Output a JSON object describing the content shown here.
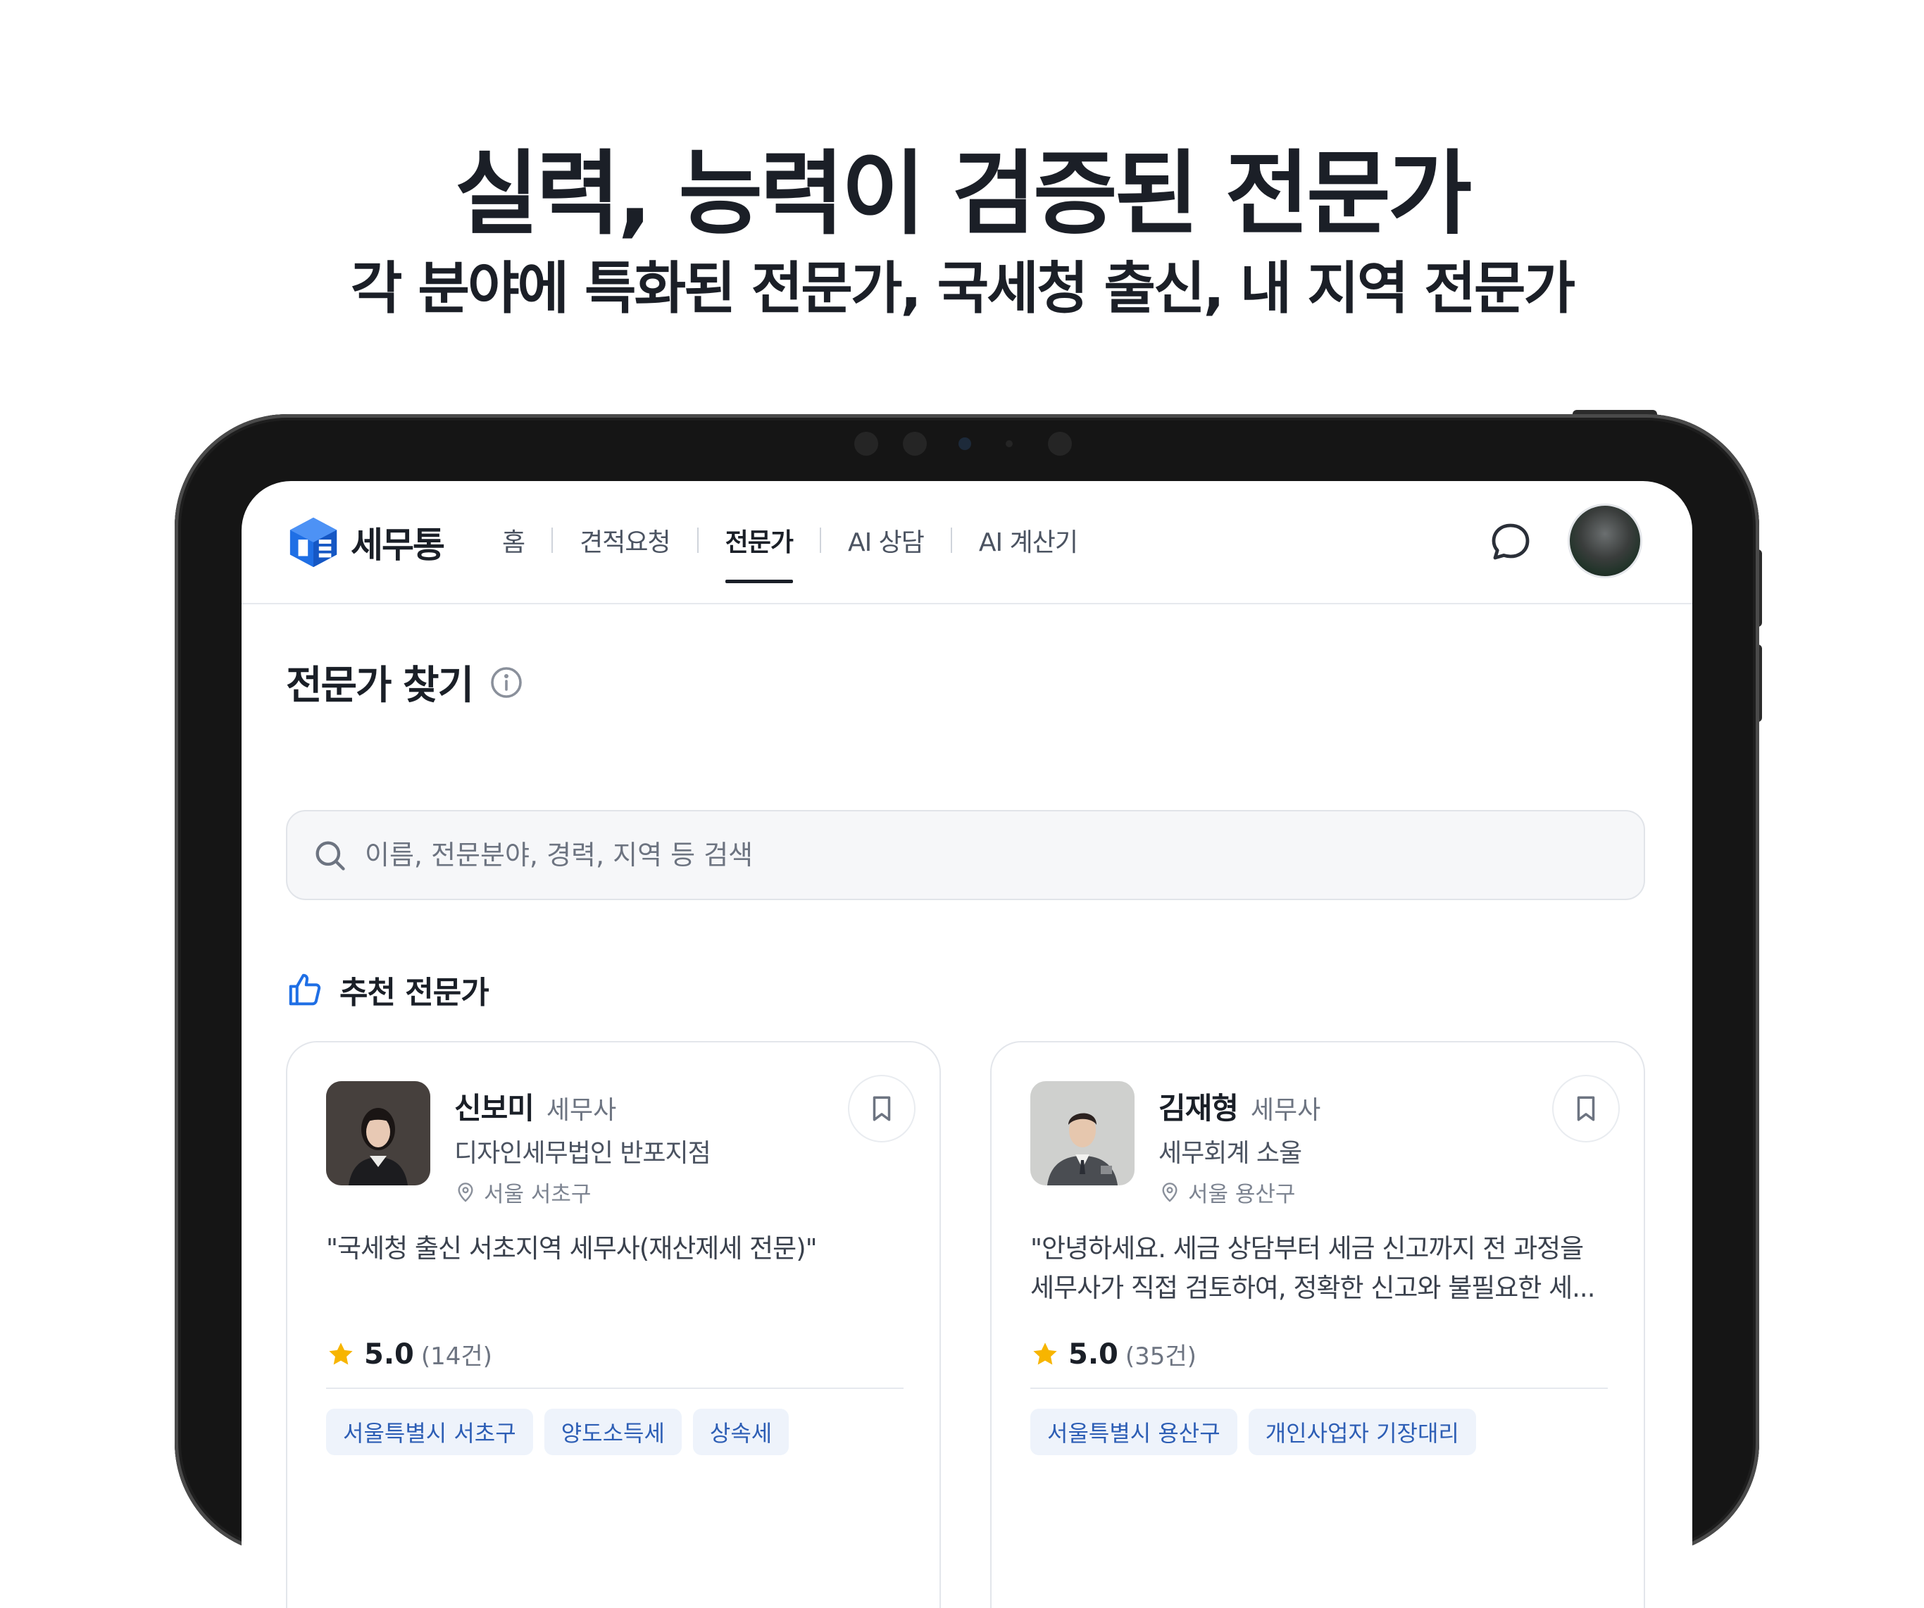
{
  "promo": {
    "headline": "실력, 능력이 검증된 전문가",
    "subline": "각 분야에 특화된 전문가, 국세청 출신, 내 지역 전문가"
  },
  "app": {
    "brand": "세무통",
    "brand_color": "#1f6fe5",
    "nav": [
      {
        "label": "홈",
        "active": false
      },
      {
        "label": "견적요청",
        "active": false
      },
      {
        "label": "전문가",
        "active": true
      },
      {
        "label": "AI 상담",
        "active": false
      },
      {
        "label": "AI 계산기",
        "active": false
      }
    ],
    "header_icons": [
      "chat-bubble-icon",
      "user-avatar"
    ]
  },
  "page": {
    "title": "전문가 찾기",
    "search": {
      "placeholder": "이름, 전문분야, 경력, 지역 등 검색",
      "value": ""
    },
    "section_title": "추천 전문가"
  },
  "experts": [
    {
      "name": "신보미",
      "role": "세무사",
      "firm": "디자인세무법인 반포지점",
      "location": "서울 서초구",
      "quote": "\"국세청 출신 서초지역 세무사(재산제세 전문)\"",
      "rating": "5.0",
      "reviews": "(14건)",
      "tags": [
        "서울특별시 서초구",
        "양도소득세",
        "상속세"
      ]
    },
    {
      "name": "김재형",
      "role": "세무사",
      "firm": "세무회계 소울",
      "location": "서울 용산구",
      "quote": "\"안녕하세요. 세금 상담부터 세금 신고까지 전 과정을 세무사가 직접 검토하여, 정확한 신고와 불필요한 세...",
      "rating": "5.0",
      "reviews": "(35건)",
      "tags": [
        "서울특별시 용산구",
        "개인사업자 기장대리"
      ]
    }
  ],
  "colors": {
    "star": "#f7b500",
    "tag_bg": "#eef3fb",
    "tag_text": "#2d5eb5"
  }
}
